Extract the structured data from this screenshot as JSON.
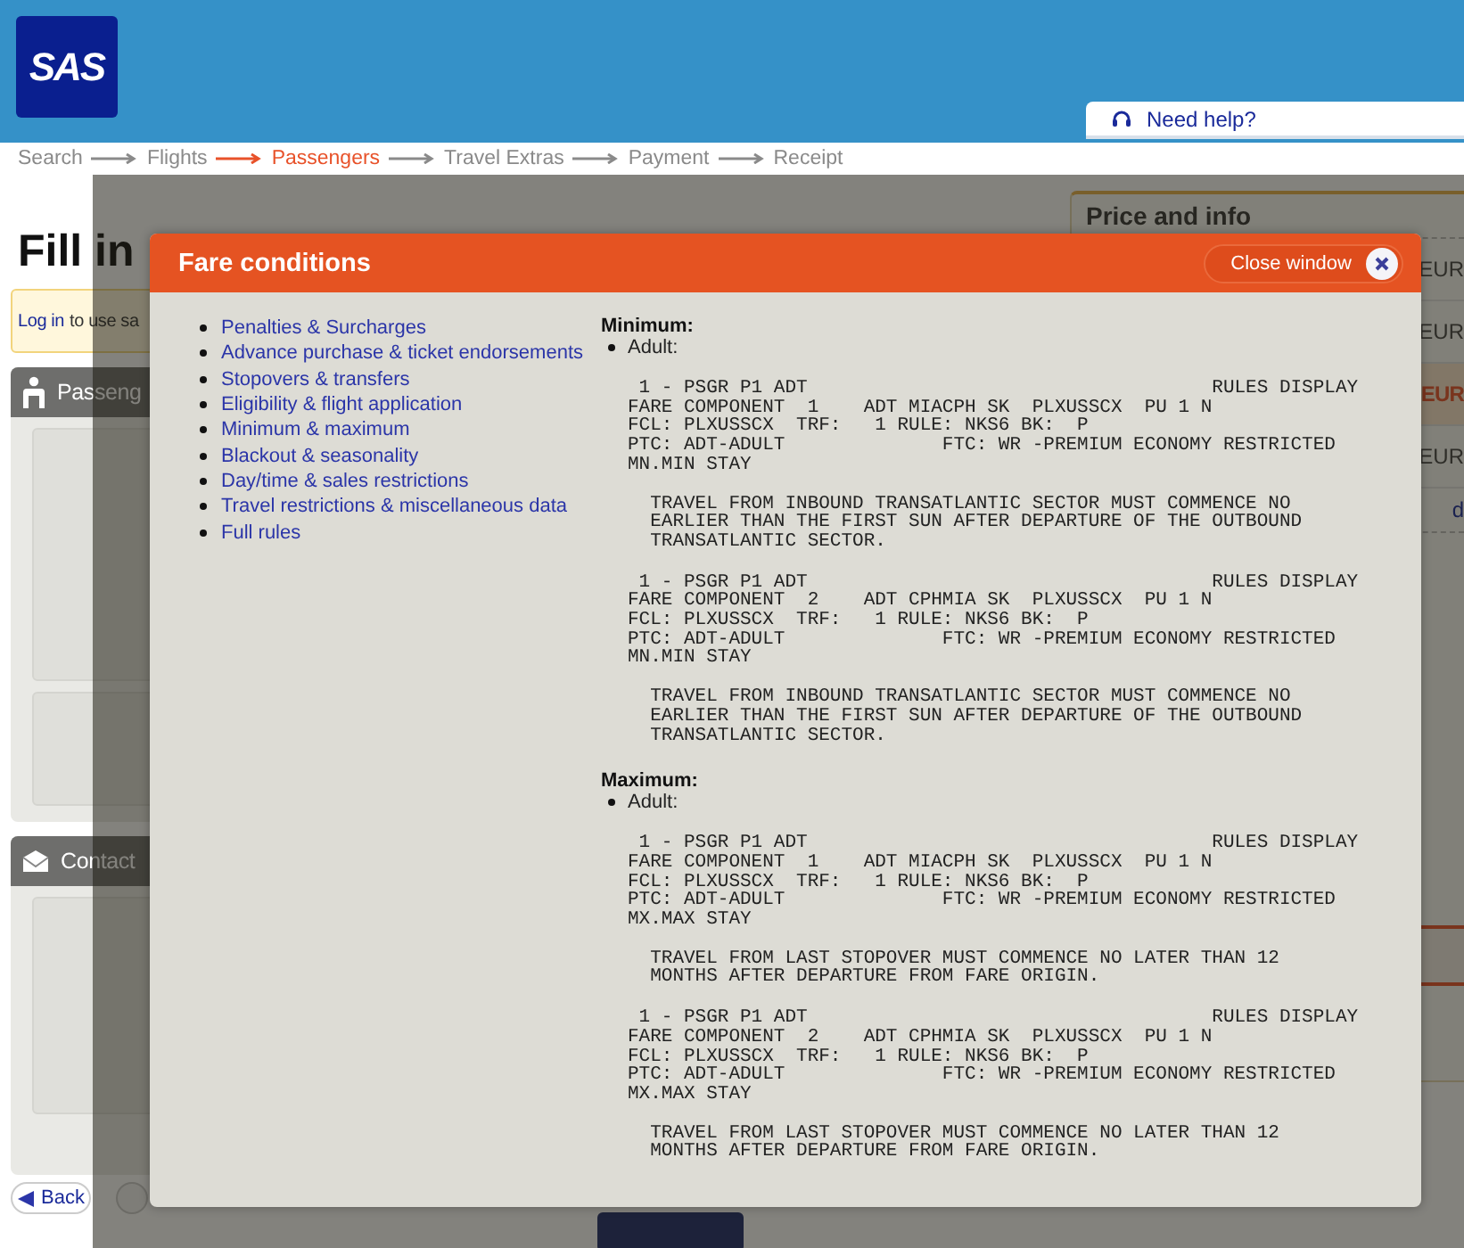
{
  "header": {
    "logo": "SAS",
    "help_link": "Need help?"
  },
  "steps": [
    {
      "label": "Search",
      "selected": false
    },
    {
      "label": "Flights",
      "selected": false
    },
    {
      "label": "Passengers",
      "selected": true
    },
    {
      "label": "Travel Extras",
      "selected": false
    },
    {
      "label": "Payment",
      "selected": false
    },
    {
      "label": "Receipt",
      "selected": false
    }
  ],
  "page": {
    "title": "Fill in",
    "login_link": "Log in",
    "login_text": "to use sa",
    "panels": [
      {
        "kind": "passenger",
        "title": "Passeng"
      },
      {
        "kind": "contact",
        "title": "Contact"
      }
    ],
    "back_button": "Back"
  },
  "price_panel": {
    "title": "Price and info",
    "rows": [
      {
        "kind": "plain",
        "text": "EUR"
      },
      {
        "kind": "plain",
        "text": "EUR"
      },
      {
        "kind": "total",
        "text": "EUR"
      },
      {
        "kind": "plain",
        "text": "EUR"
      },
      {
        "kind": "link",
        "text": "d"
      }
    ]
  },
  "dialog": {
    "title": "Fare conditions",
    "close_label": "Close window",
    "links": [
      "Penalties & Surcharges",
      "Advance purchase & ticket endorsements",
      "Stopovers & transfers",
      "Eligibility & flight application",
      "Minimum & maximum",
      "Blackout & seasonality",
      "Day/time & sales restrictions",
      "Travel restrictions & miscellaneous data",
      "Full rules"
    ],
    "sections": [
      {
        "heading": "Minimum:",
        "passenger": "Adult:",
        "blocks": [
          {
            "rule_lines": [
              " 1 - PSGR P1 ADT                                    RULES DISPLAY",
              "FARE COMPONENT  1    ADT MIACPH SK  PLXUSSCX  PU 1 N",
              "FCL: PLXUSSCX  TRF:   1 RULE: NKS6 BK:  P",
              "PTC: ADT-ADULT              FTC: WR -PREMIUM ECONOMY RESTRICTED",
              "MN.MIN STAY"
            ],
            "note_lines": [
              "  TRAVEL FROM INBOUND TRANSATLANTIC SECTOR MUST COMMENCE NO",
              "  EARLIER THAN THE FIRST SUN AFTER DEPARTURE OF THE OUTBOUND",
              "  TRANSATLANTIC SECTOR."
            ]
          },
          {
            "rule_lines": [
              " 1 - PSGR P1 ADT                                    RULES DISPLAY",
              "FARE COMPONENT  2    ADT CPHMIA SK  PLXUSSCX  PU 1 N",
              "FCL: PLXUSSCX  TRF:   1 RULE: NKS6 BK:  P",
              "PTC: ADT-ADULT              FTC: WR -PREMIUM ECONOMY RESTRICTED",
              "MN.MIN STAY"
            ],
            "note_lines": [
              "  TRAVEL FROM INBOUND TRANSATLANTIC SECTOR MUST COMMENCE NO",
              "  EARLIER THAN THE FIRST SUN AFTER DEPARTURE OF THE OUTBOUND",
              "  TRANSATLANTIC SECTOR."
            ]
          }
        ]
      },
      {
        "heading": "Maximum:",
        "passenger": "Adult:",
        "blocks": [
          {
            "rule_lines": [
              " 1 - PSGR P1 ADT                                    RULES DISPLAY",
              "FARE COMPONENT  1    ADT MIACPH SK  PLXUSSCX  PU 1 N",
              "FCL: PLXUSSCX  TRF:   1 RULE: NKS6 BK:  P",
              "PTC: ADT-ADULT              FTC: WR -PREMIUM ECONOMY RESTRICTED",
              "MX.MAX STAY"
            ],
            "note_lines": [
              "  TRAVEL FROM LAST STOPOVER MUST COMMENCE NO LATER THAN 12",
              "  MONTHS AFTER DEPARTURE FROM FARE ORIGIN."
            ]
          },
          {
            "rule_lines": [
              " 1 - PSGR P1 ADT                                    RULES DISPLAY",
              "FARE COMPONENT  2    ADT CPHMIA SK  PLXUSSCX  PU 1 N",
              "FCL: PLXUSSCX  TRF:   1 RULE: NKS6 BK:  P",
              "PTC: ADT-ADULT              FTC: WR -PREMIUM ECONOMY RESTRICTED",
              "MX.MAX STAY"
            ],
            "note_lines": [
              "  TRAVEL FROM LAST STOPOVER MUST COMMENCE NO LATER THAN 12",
              "  MONTHS AFTER DEPARTURE FROM FARE ORIGIN."
            ]
          }
        ]
      }
    ]
  }
}
